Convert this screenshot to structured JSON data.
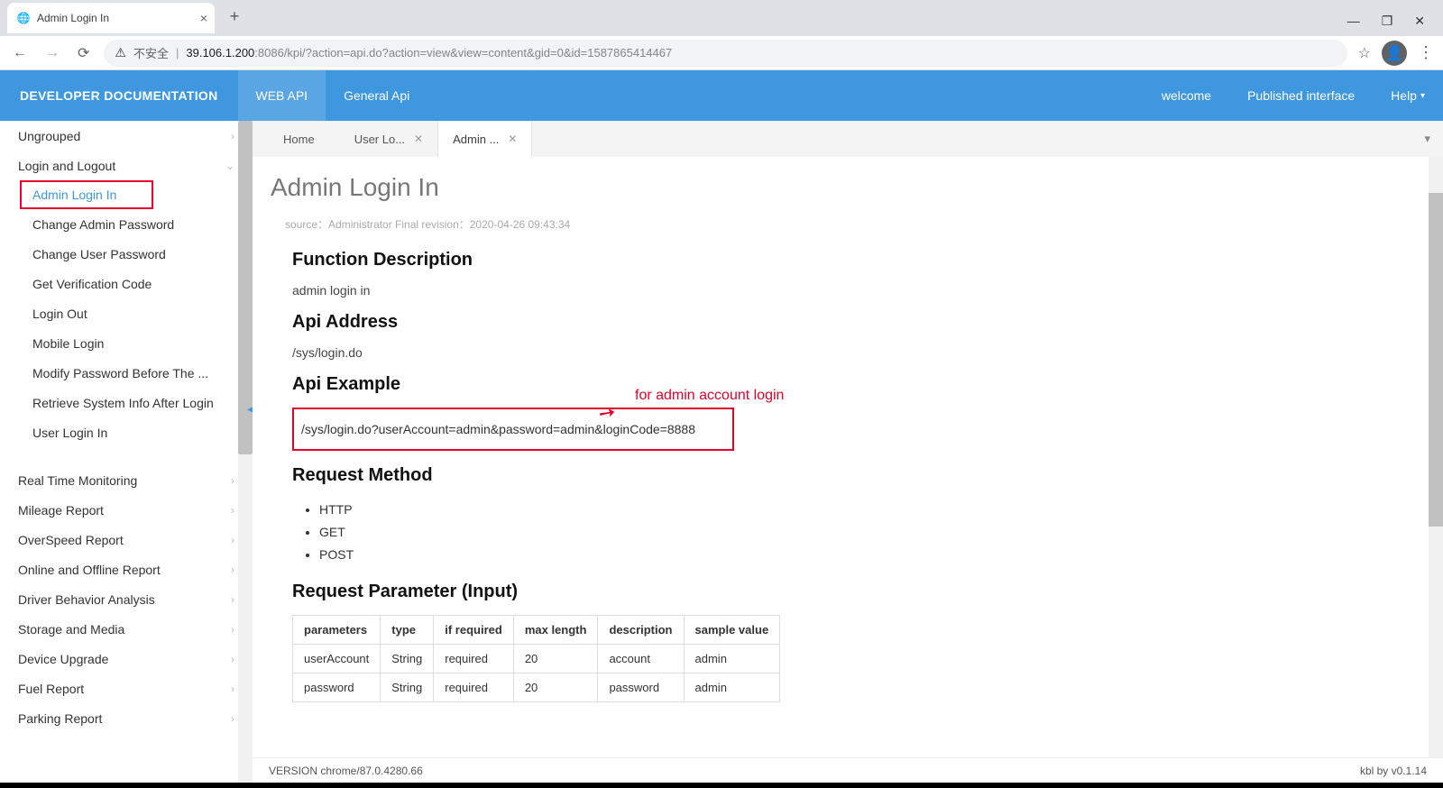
{
  "browser": {
    "tab_title": "Admin Login In",
    "not_secure": "不安全",
    "url_host": "39.106.1.200",
    "url_port_path": ":8086/kpi/?action=api.do?action=view&view=content&gid=0&id=1587865414467"
  },
  "nav": {
    "brand": "DEVELOPER DOCUMENTATION",
    "items": [
      "WEB API",
      "General Api"
    ],
    "right": [
      "welcome",
      "Published interface",
      "Help"
    ]
  },
  "sidebar": {
    "groups": [
      {
        "label": "Ungrouped",
        "expand": "›"
      },
      {
        "label": "Login and Logout",
        "expand": "⌄",
        "children": [
          "Admin Login In",
          "Change Admin Password",
          "Change User Password",
          "Get Verification Code",
          "Login Out",
          "Mobile Login",
          "Modify Password Before The ...",
          "Retrieve System Info After Login",
          "User Login In"
        ]
      },
      {
        "label": "Real Time Monitoring",
        "expand": "›"
      },
      {
        "label": "Mileage Report",
        "expand": "›"
      },
      {
        "label": "OverSpeed Report",
        "expand": "›"
      },
      {
        "label": "Online and Offline Report",
        "expand": "›"
      },
      {
        "label": "Driver Behavior Analysis",
        "expand": "›"
      },
      {
        "label": "Storage and Media",
        "expand": "›"
      },
      {
        "label": "Device Upgrade",
        "expand": "›"
      },
      {
        "label": "Fuel Report",
        "expand": "›"
      },
      {
        "label": "Parking Report",
        "expand": "›"
      }
    ]
  },
  "contentTabs": {
    "home": "Home",
    "tab1": "User Lo...",
    "tab2": "Admin ..."
  },
  "page": {
    "title": "Admin Login In",
    "meta_source_label": "source：",
    "meta_source": "Administrator",
    "meta_rev_label": " Final revision：",
    "meta_rev": "2020-04-26 09:43:34",
    "sec_desc": "Function Description",
    "desc": "admin login in",
    "sec_addr": "Api Address",
    "addr": "/sys/login.do",
    "sec_example": "Api Example",
    "example": "/sys/login.do?userAccount=admin&password=admin&loginCode=8888",
    "annotation": "for admin account login",
    "sec_method": "Request Method",
    "methods": [
      "HTTP",
      "GET",
      "POST"
    ],
    "sec_params": "Request Parameter (Input)",
    "param_headers": [
      "parameters",
      "type",
      "if required",
      "max length",
      "description",
      "sample value"
    ],
    "param_rows": [
      [
        "userAccount",
        "String",
        "required",
        "20",
        "account",
        "admin"
      ],
      [
        "password",
        "String",
        "required",
        "20",
        "password",
        "admin"
      ]
    ]
  },
  "footer": {
    "version": "VERSION chrome/87.0.4280.66",
    "right": "kbl by v0.1.14"
  }
}
